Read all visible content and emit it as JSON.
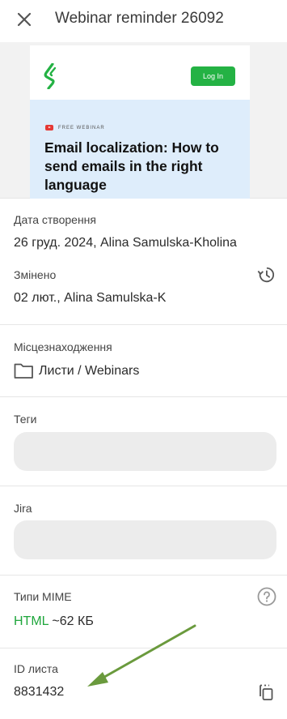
{
  "header": {
    "title": "Webinar reminder 26092"
  },
  "preview": {
    "login_label": "Log In",
    "tag": "FREE WEBINAR",
    "headline": "Email localization: How to send emails in the right language"
  },
  "created": {
    "label": "Дата створення",
    "value": "26 груд. 2024, Alina Samulska-Kholina"
  },
  "modified": {
    "label": "Змінено",
    "value": "02 лют., Alina Samulska-K"
  },
  "location": {
    "label": "Місцезнаходження",
    "path": "Листи / Webinars"
  },
  "tags": {
    "label": "Теги"
  },
  "jira": {
    "label": "Jira"
  },
  "mime": {
    "label": "Типи MIME",
    "type": "HTML",
    "size": "~62 КБ"
  },
  "letter_id": {
    "label": "ID листа",
    "value": "8831432"
  },
  "colors": {
    "accent": "#1fa63c",
    "arrow": "#6a9a3d",
    "preview_bg": "#deedfb"
  }
}
